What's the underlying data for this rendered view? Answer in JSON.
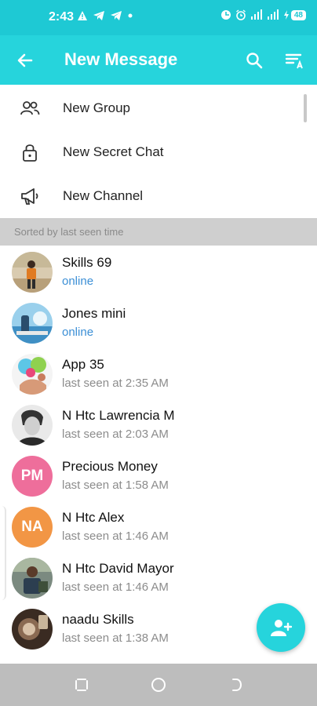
{
  "status_bar": {
    "time": "2:43",
    "battery": "48",
    "left_icons": [
      "warning-icon",
      "telegram-icon",
      "telegram-icon",
      "dot-icon"
    ],
    "right_icons": [
      "data-saver-icon",
      "alarm-icon",
      "signal-icon",
      "signal-icon",
      "battery-icon"
    ]
  },
  "app_bar": {
    "title": "New Message",
    "back_icon": "arrow-left-icon",
    "search_icon": "search-icon",
    "sort_icon": "sort-az-icon"
  },
  "actions": [
    {
      "label": "New Group",
      "icon": "group-icon"
    },
    {
      "label": "New Secret Chat",
      "icon": "lock-icon"
    },
    {
      "label": "New Channel",
      "icon": "megaphone-icon"
    }
  ],
  "section_header": "Sorted by last seen time",
  "contacts": [
    {
      "name": "Skills 69",
      "status": "online",
      "online": true,
      "avatar": "photo"
    },
    {
      "name": "Jones mini",
      "status": "online",
      "online": true,
      "avatar": "photo"
    },
    {
      "name": "App 35",
      "status": "last seen at 2:35 AM",
      "online": false,
      "avatar": "photo"
    },
    {
      "name": "N Htc Lawrencia M",
      "status": "last seen at 2:03 AM",
      "online": false,
      "avatar": "photo"
    },
    {
      "name": "Precious Money",
      "status": "last seen at 1:58 AM",
      "online": false,
      "avatar": "initials",
      "initials": "PM",
      "color": "#ee6e9b"
    },
    {
      "name": "N Htc Alex",
      "status": "last seen at 1:46 AM",
      "online": false,
      "avatar": "initials",
      "initials": "NA",
      "color": "#f29645"
    },
    {
      "name": "N Htc David Mayor",
      "status": "last seen at 1:46 AM",
      "online": false,
      "avatar": "photo"
    },
    {
      "name": "naadu Skills",
      "status": "last seen at 1:38 AM",
      "online": false,
      "avatar": "photo"
    }
  ],
  "fab": {
    "icon": "add-contact-icon"
  },
  "nav": [
    "recents-icon",
    "home-icon",
    "back-icon"
  ]
}
